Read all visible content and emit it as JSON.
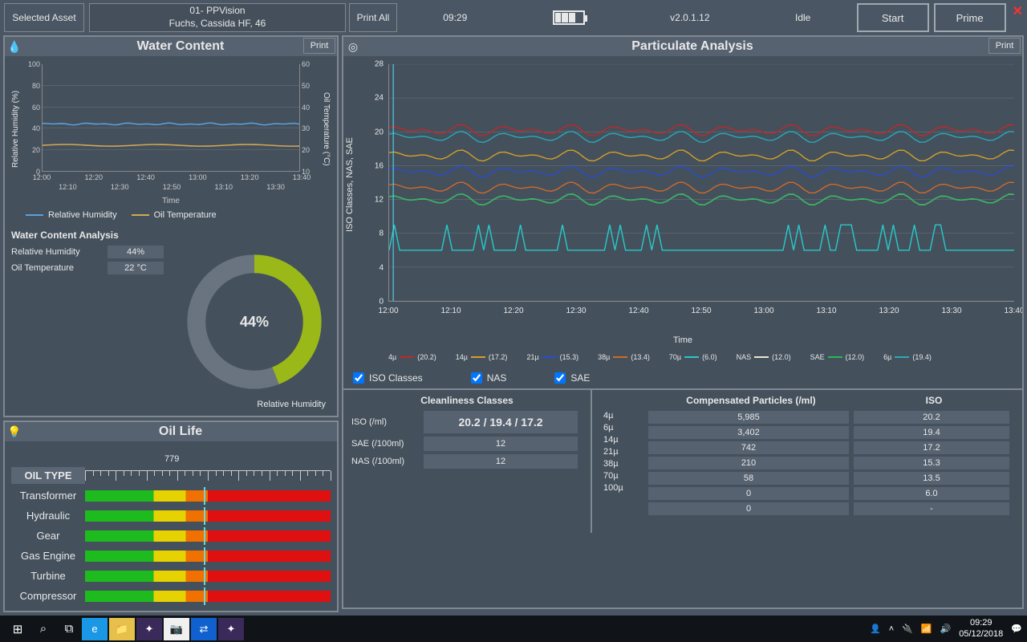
{
  "topbar": {
    "selected_asset_label": "Selected Asset",
    "asset_line1": "01- PPVision",
    "asset_line2": "Fuchs, Cassida HF, 46",
    "print_all": "Print All",
    "time": "09:29",
    "version": "v2.0.1.12",
    "status": "Idle",
    "start_btn": "Start",
    "prime_btn": "Prime"
  },
  "water_panel": {
    "title": "Water Content",
    "print": "Print",
    "y_left_label": "Relative Humidity (%)",
    "y_right_label": "Oil Temperature (°C)",
    "x_label": "Time",
    "legend_rh": "Relative Humidity",
    "legend_ot": "Oil Temperature",
    "analysis_title": "Water Content Analysis",
    "rows": [
      {
        "label": "Relative Humidity",
        "value": "44%"
      },
      {
        "label": "Oil Temperature",
        "value": "22 °C"
      }
    ],
    "donut_value": "44%",
    "donut_label": "Relative Humidity"
  },
  "oil_life": {
    "title": "Oil Life",
    "pointer_value": "779",
    "header": "OIL TYPE",
    "rows": [
      "Transformer",
      "Hydraulic",
      "Gear",
      "Gas Engine",
      "Turbine",
      "Compressor"
    ]
  },
  "particulate": {
    "title": "Particulate Analysis",
    "print": "Print",
    "y_label": "ISO Classes, NAS, SAE",
    "x_label": "Time",
    "x_ticks": [
      "12:00",
      "12:10",
      "12:20",
      "12:30",
      "12:40",
      "12:50",
      "13:00",
      "13:10",
      "13:20",
      "13:30",
      "13:40"
    ],
    "y_ticks": [
      "0",
      "4",
      "8",
      "12",
      "16",
      "20",
      "24",
      "28"
    ],
    "legend": [
      {
        "label": "4µ",
        "val": "(20.2)",
        "color": "#c02828"
      },
      {
        "label": "14µ",
        "val": "(17.2)",
        "color": "#d4a028"
      },
      {
        "label": "21µ",
        "val": "(15.3)",
        "color": "#2a4cd0"
      },
      {
        "label": "38µ",
        "val": "(13.4)",
        "color": "#d06a28"
      },
      {
        "label": "70µ",
        "val": "(6.0)",
        "color": "#28c8c8"
      },
      {
        "label": "NAS",
        "val": "(12.0)",
        "color": "#e8e8d0"
      },
      {
        "label": "SAE",
        "val": "(12.0)",
        "color": "#28b858"
      },
      {
        "label": "6µ",
        "val": "(19.4)",
        "color": "#28aab8"
      }
    ],
    "checks": {
      "iso": "ISO Classes",
      "nas": "NAS",
      "sae": "SAE"
    },
    "clean_title": "Cleanliness Classes",
    "clean_rows": [
      {
        "k": "ISO (/ml)",
        "v": "20.2 / 19.4 / 17.2",
        "big": true
      },
      {
        "k": "SAE (/100ml)",
        "v": "12"
      },
      {
        "k": "NAS (/100ml)",
        "v": "12"
      }
    ],
    "comp_title": "Compensated Particles (/ml)",
    "iso_title": "ISO",
    "comp_rows": [
      {
        "k": "4µ",
        "cp": "5,985",
        "iso": "20.2"
      },
      {
        "k": "6µ",
        "cp": "3,402",
        "iso": "19.4"
      },
      {
        "k": "14µ",
        "cp": "742",
        "iso": "17.2"
      },
      {
        "k": "21µ",
        "cp": "210",
        "iso": "15.3"
      },
      {
        "k": "38µ",
        "cp": "58",
        "iso": "13.5"
      },
      {
        "k": "70µ",
        "cp": "0",
        "iso": "6.0"
      },
      {
        "k": "100µ",
        "cp": "0",
        "iso": "-"
      }
    ]
  },
  "taskbar": {
    "time": "09:29",
    "date": "05/12/2018"
  },
  "chart_data": {
    "water_content": {
      "type": "line",
      "x_ticks_top": [
        "12:00",
        "12:20",
        "12:40",
        "13:00",
        "13:20",
        "13:40"
      ],
      "x_ticks_bottom": [
        "12:10",
        "12:30",
        "12:50",
        "13:10",
        "13:30"
      ],
      "y_left_ticks": [
        0,
        20,
        40,
        60,
        80,
        100
      ],
      "y_right_ticks": [
        10,
        20,
        30,
        40,
        50,
        60
      ],
      "series": [
        {
          "name": "Relative Humidity",
          "axis": "left",
          "approx_constant": 44,
          "color": "#5aa0dc"
        },
        {
          "name": "Oil Temperature",
          "axis": "right",
          "approx_constant": 22,
          "color": "#d4a854"
        }
      ]
    },
    "donut": {
      "type": "pie",
      "value": 44,
      "max": 100,
      "label": "Relative Humidity"
    },
    "particulate": {
      "type": "line",
      "xlabel": "Time",
      "ylabel": "ISO Classes, NAS, SAE",
      "x": [
        "12:00",
        "12:10",
        "12:20",
        "12:30",
        "12:40",
        "12:50",
        "13:00",
        "13:10",
        "13:20",
        "13:30",
        "13:40"
      ],
      "ylim": [
        0,
        28
      ],
      "series": [
        {
          "name": "4µ",
          "approx": 20.2,
          "color": "#c02828"
        },
        {
          "name": "6µ",
          "approx": 19.4,
          "color": "#28aab8"
        },
        {
          "name": "14µ",
          "approx": 17.2,
          "color": "#d4a028"
        },
        {
          "name": "21µ",
          "approx": 15.3,
          "color": "#2a4cd0"
        },
        {
          "name": "38µ",
          "approx": 13.4,
          "color": "#d06a28"
        },
        {
          "name": "NAS",
          "approx": 12.0,
          "color": "#e8e8d0"
        },
        {
          "name": "SAE",
          "approx": 12.0,
          "color": "#28b858"
        },
        {
          "name": "70µ",
          "approx": 6.0,
          "color": "#28c8c8"
        }
      ]
    },
    "oil_life": {
      "type": "bar",
      "value": 779,
      "max": 1600
    }
  }
}
